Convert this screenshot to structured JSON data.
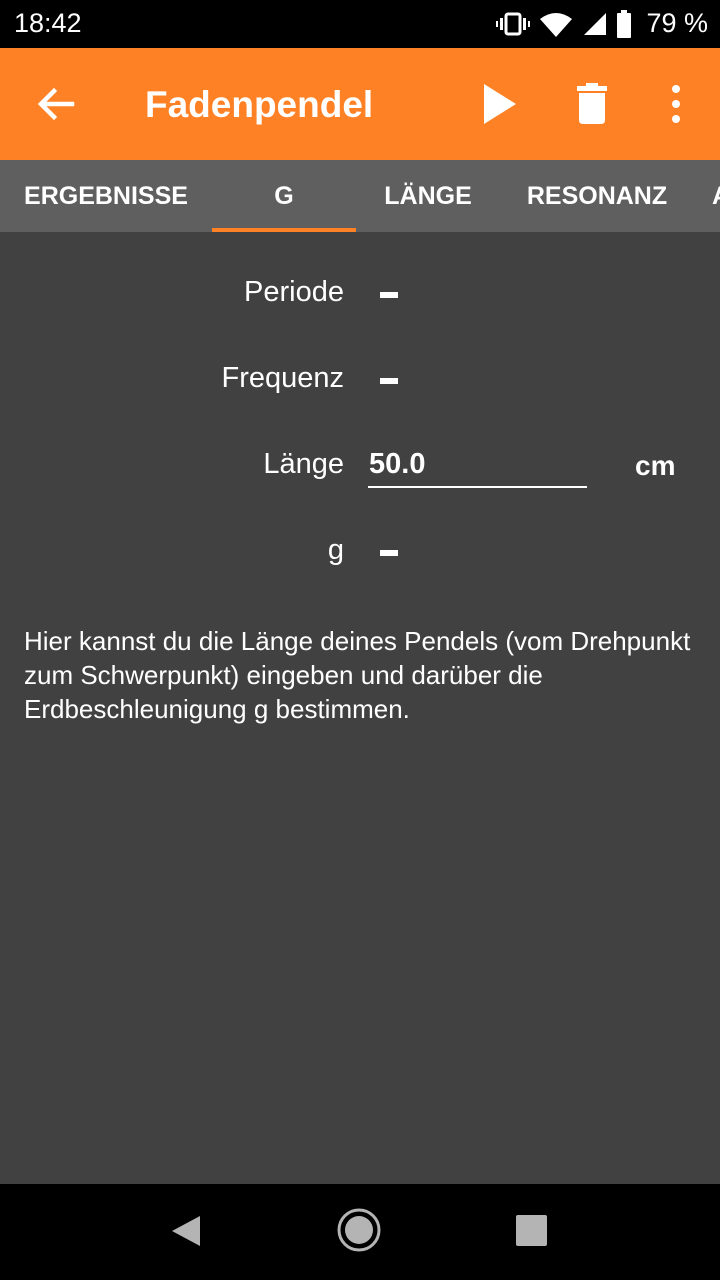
{
  "status": {
    "time": "18:42",
    "battery_percent": "79 %",
    "icons": [
      "vibrate-icon",
      "wifi-icon",
      "signal-icon",
      "battery-icon"
    ]
  },
  "appbar": {
    "title": "Fadenpendel",
    "background": "#ff8125",
    "actions": [
      "back-arrow-icon",
      "play-icon",
      "trash-icon",
      "more-vert-icon"
    ]
  },
  "tabs": [
    {
      "label": "ERGEBNISSE",
      "selected": false
    },
    {
      "label": "G",
      "selected": true
    },
    {
      "label": "LÄNGE",
      "selected": false
    },
    {
      "label": "RESONANZ",
      "selected": false
    },
    {
      "label": "A",
      "selected": false
    }
  ],
  "form": {
    "period_label": "Periode",
    "frequency_label": "Frequenz",
    "length_label": "Länge",
    "length_value": "50.0",
    "length_unit": "cm",
    "g_label": "g"
  },
  "description": "Hier kannst du die Länge deines Pendels (vom Drehpunkt zum Schwerpunkt) eingeben und darüber die Erdbeschleunigung g bestimmen."
}
